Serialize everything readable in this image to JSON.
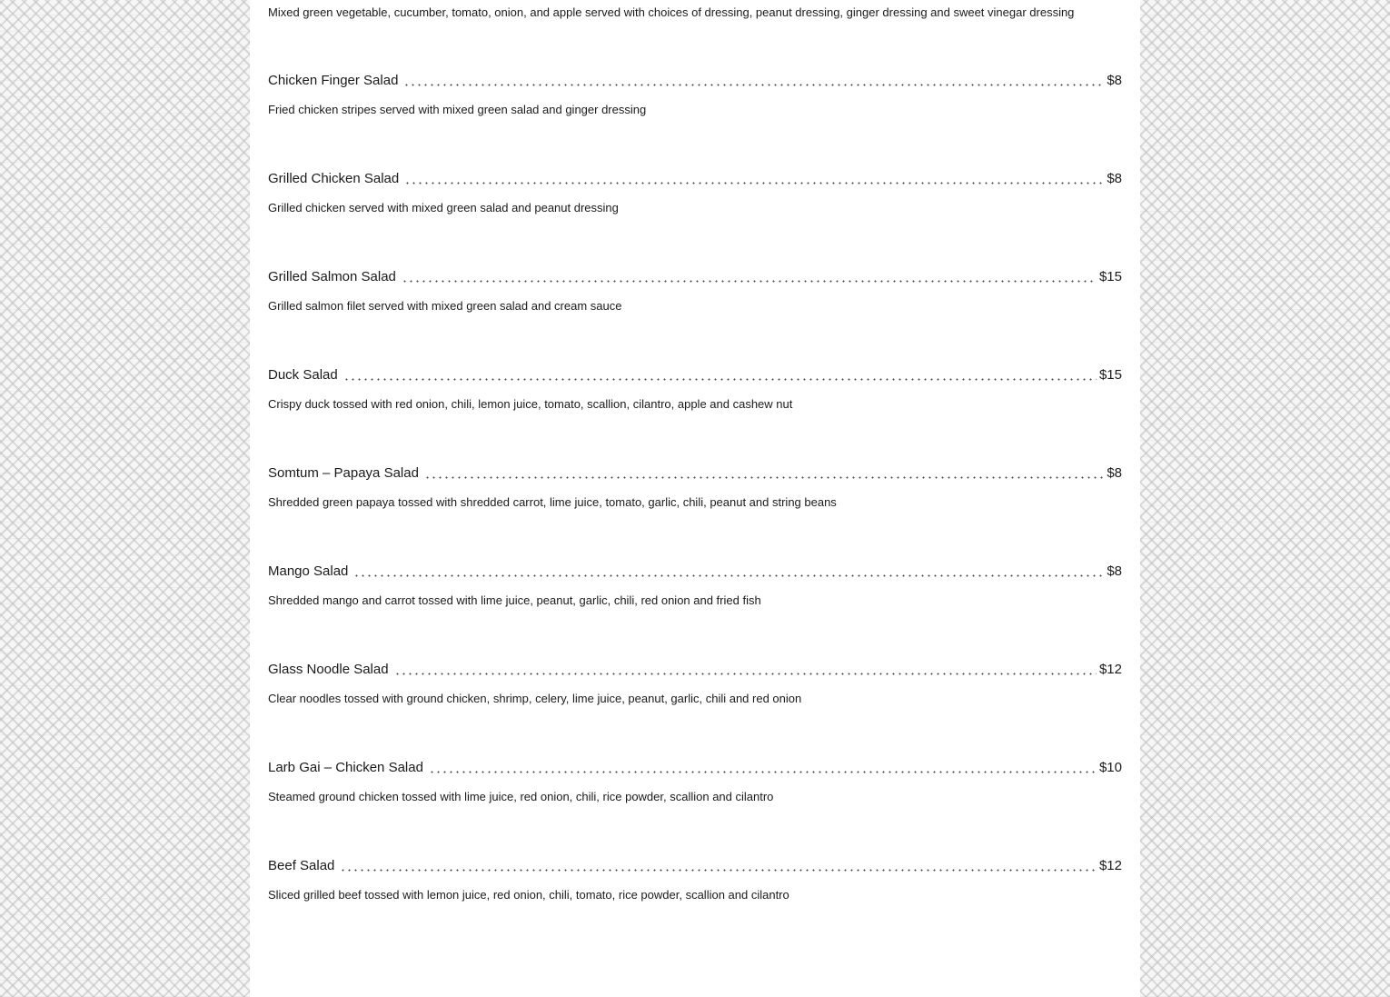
{
  "intro": {
    "description": "Mixed green vegetable, cucumber, tomato, onion, and apple served with choices of dressing, peanut dressing, ginger dressing and sweet vinegar dressing"
  },
  "items": [
    {
      "name": "Chicken Finger Salad",
      "price": "$8",
      "description": "Fried chicken stripes served with mixed green salad and ginger dressing"
    },
    {
      "name": "Grilled Chicken Salad",
      "price": "$8",
      "description": "Grilled chicken served with mixed green salad and peanut dressing"
    },
    {
      "name": "Grilled Salmon Salad",
      "price": "$15",
      "description": "Grilled salmon filet served with mixed green salad and cream sauce"
    },
    {
      "name": "Duck Salad",
      "price": "$15",
      "description": "Crispy duck tossed with red onion, chili, lemon juice, tomato, scallion, cilantro, apple and cashew nut"
    },
    {
      "name": "Somtum – Papaya Salad",
      "price": "$8",
      "description": "Shredded green papaya tossed with shredded carrot, lime juice, tomato, garlic, chili, peanut and string beans"
    },
    {
      "name": "Mango Salad",
      "price": "$8",
      "description": "Shredded mango and carrot tossed with lime juice, peanut, garlic, chili, red onion and fried fish"
    },
    {
      "name": "Glass Noodle Salad",
      "price": "$12",
      "description": "Clear noodles tossed with ground chicken, shrimp, celery, lime juice, peanut, garlic, chili and red onion"
    },
    {
      "name": "Larb Gai – Chicken Salad",
      "price": "$10",
      "description": "Steamed ground chicken tossed with lime juice, red onion, chili, rice powder, scallion and cilantro"
    },
    {
      "name": "Beef Salad",
      "price": "$12",
      "description": "Sliced grilled beef tossed with lemon juice, red onion, chili, tomato, rice powder, scallion and cilantro"
    }
  ]
}
